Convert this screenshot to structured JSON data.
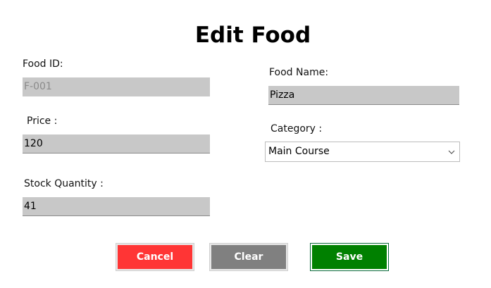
{
  "form": {
    "title": "Edit Food",
    "food_id": {
      "label": "Food ID:",
      "value": "F-001"
    },
    "food_name": {
      "label": "Food Name:",
      "value": "Pizza"
    },
    "price": {
      "label": "Price :",
      "value": "120"
    },
    "category": {
      "label": "Category :",
      "selected": "Main Course"
    },
    "stock_quantity": {
      "label": "Stock Quantity :",
      "value": "41"
    }
  },
  "buttons": {
    "cancel": "Cancel",
    "clear": "Clear",
    "save": "Save"
  },
  "icons": {
    "dropdown": "chevron-down-icon"
  },
  "colors": {
    "cancel": "#ff3535",
    "clear": "#808080",
    "save": "#008000",
    "field_bg": "#c8c8c8"
  }
}
